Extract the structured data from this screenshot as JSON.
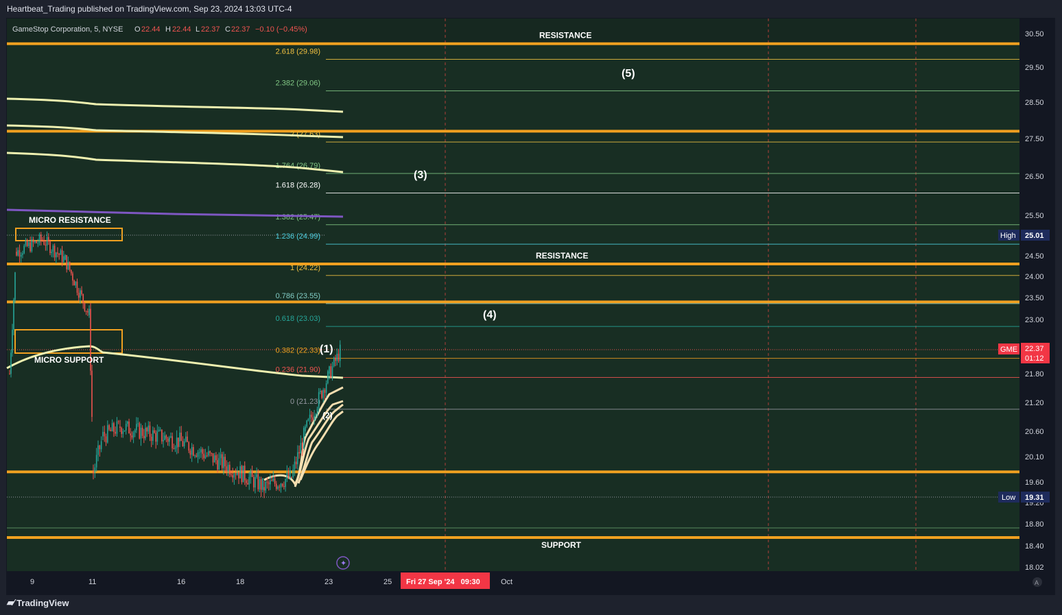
{
  "header": {
    "published": "Heartbeat_Trading published on TradingView.com, Sep 23, 2024 13:03 UTC-4"
  },
  "legend": {
    "symbol": "GameStop Corporation, 5, NYSE",
    "o_label": "O",
    "o": "22.44",
    "h_label": "H",
    "h": "22.44",
    "l_label": "L",
    "l": "22.37",
    "c_label": "C",
    "c": "22.37",
    "change": "−0.10 (−0.45%)"
  },
  "footer": {
    "brand": "TradingView"
  },
  "colors": {
    "bg": "#131722",
    "zone": "#1d3a2c",
    "orange": "#f0a020",
    "up": "#26a69a",
    "down": "#ef5350",
    "ma": "#eef0b0",
    "ma2": "#f5deb0",
    "purple": "#7e57c2",
    "red": "#f23645"
  },
  "chart_data": {
    "type": "line",
    "title": "",
    "yaxis_ticks": [
      "30.50",
      "29.50",
      "28.50",
      "27.50",
      "26.50",
      "25.50",
      "24.50",
      "24.00",
      "23.50",
      "23.00",
      "21.80",
      "21.20",
      "20.60",
      "20.10",
      "19.60",
      "19.20",
      "18.80",
      "18.40",
      "18.02"
    ],
    "xaxis_ticks": [
      "9",
      "11",
      "16",
      "18",
      "23",
      "25",
      "Oct"
    ],
    "date_badge": "Fri 27 Sep '24   09:30",
    "fib_levels": [
      {
        "label": "2.618 (29.98)",
        "value": 29.98,
        "color": "#f0c040"
      },
      {
        "label": "2.382 (29.06)",
        "value": 29.06,
        "color": "#81c784"
      },
      {
        "label": "2 (27.63)",
        "value": 27.63,
        "color": "#f0c040"
      },
      {
        "label": "1.764 (26.79)",
        "value": 26.79,
        "color": "#81c784"
      },
      {
        "label": "1.618 (26.28)",
        "value": 26.28,
        "color": "#ffffff"
      },
      {
        "label": "1.382 (25.47)",
        "value": 25.47,
        "color": "#81c784"
      },
      {
        "label": "1.236 (24.99)",
        "value": 24.99,
        "color": "#4dd0e1"
      },
      {
        "label": "1 (24.22)",
        "value": 24.22,
        "color": "#f0c040"
      },
      {
        "label": "0.786 (23.55)",
        "value": 23.55,
        "color": "#80cbc4"
      },
      {
        "label": "0.618 (23.03)",
        "value": 23.03,
        "color": "#26a69a"
      },
      {
        "label": "0.382 (22.33)",
        "value": 22.33,
        "color": "#f0a020"
      },
      {
        "label": "0.236 (21.90)",
        "value": 21.9,
        "color": "#ef5350"
      },
      {
        "label": "0 (21.23)",
        "value": 21.23,
        "color": "#9598a1"
      }
    ],
    "horizontal_levels": [
      {
        "label": "RESISTANCE",
        "value": 30.2
      },
      {
        "label": "",
        "value": 27.7
      },
      {
        "label": "RESISTANCE",
        "value": 24.3
      },
      {
        "label": "",
        "value": 23.4
      },
      {
        "label": "",
        "value": 19.8
      },
      {
        "label": "SUPPORT",
        "value": 18.55
      }
    ],
    "zone_labels": {
      "micro_resistance": "MICRO RESISTANCE",
      "micro_support": "MICRO SUPPORT"
    },
    "wave_labels": [
      "(1)",
      "(2)",
      "(3)",
      "(4)",
      "(5)"
    ],
    "price_tags": {
      "high_label": "High",
      "high": "25.01",
      "low_label": "Low",
      "low": "19.31",
      "symbol": "GME",
      "last": "22.37",
      "countdown": "01:12"
    },
    "approx_price_path": [
      {
        "x": "9",
        "y": 21.8
      },
      {
        "x": "9",
        "y": 24.6
      },
      {
        "x": "9",
        "y": 24.9
      },
      {
        "x": "10",
        "y": 24.4
      },
      {
        "x": "10",
        "y": 23.1
      },
      {
        "x": "11",
        "y": 19.8
      },
      {
        "x": "11",
        "y": 20.5
      },
      {
        "x": "12",
        "y": 20.7
      },
      {
        "x": "16",
        "y": 20.4
      },
      {
        "x": "18",
        "y": 19.8
      },
      {
        "x": "19",
        "y": 19.5
      },
      {
        "x": "20",
        "y": 19.7
      },
      {
        "x": "20",
        "y": 20.6
      },
      {
        "x": "23",
        "y": 21.8
      },
      {
        "x": "23",
        "y": 22.37
      }
    ]
  }
}
